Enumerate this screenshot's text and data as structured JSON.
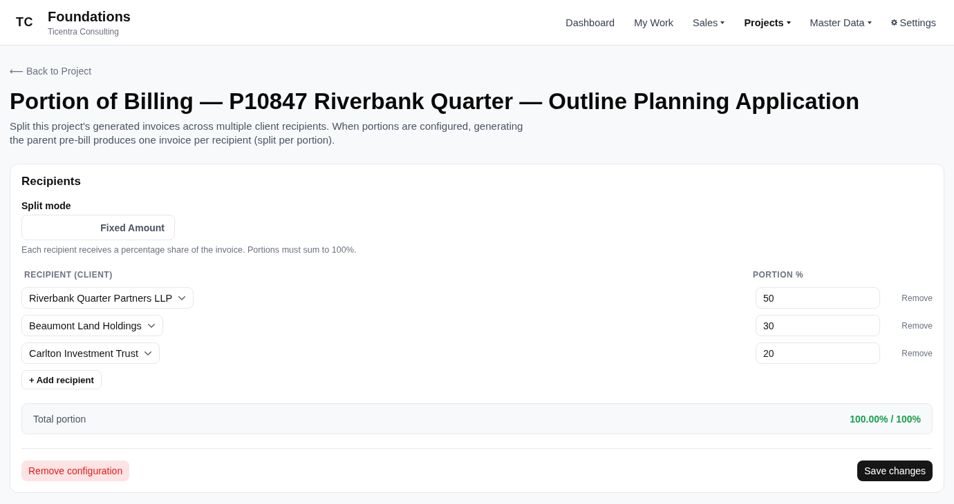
{
  "header": {
    "logo": "TC",
    "title": "Foundations",
    "subtitle": "Ticentra Consulting",
    "nav": [
      {
        "label": "Dashboard",
        "kind": "link",
        "selected": false
      },
      {
        "label": "My Work",
        "kind": "link",
        "selected": false
      },
      {
        "label": "Sales",
        "kind": "dropdown",
        "selected": false
      },
      {
        "label": "Projects",
        "kind": "dropdown",
        "selected": true
      },
      {
        "label": "Master Data",
        "kind": "dropdown",
        "selected": false
      },
      {
        "label": "Settings",
        "kind": "settings",
        "selected": false
      }
    ]
  },
  "back_link": "⟵ Back to Project",
  "title": "Portion of Billing — P10847 Riverbank Quarter — Outline Planning Application",
  "description": "Split this project's generated invoices across multiple client recipients. When portions are configured, generating the parent pre-bill produces one invoice per recipient (split per portion).",
  "recipients_card": {
    "heading": "Recipients",
    "split_mode": {
      "label": "Split mode",
      "options": [
        {
          "label": "Fixed Amount",
          "selected": false
        }
      ],
      "help": "Each recipient receives a percentage share of the invoice. Portions must sum to 100%."
    },
    "columns": [
      "RECIPIENT (CLIENT)",
      "PORTION %"
    ],
    "rows": [
      {
        "recipient": "Riverbank Quarter Partners LLP",
        "portion": "50",
        "action": "Remove"
      },
      {
        "recipient": "Beaumont Land Holdings",
        "portion": "30",
        "action": "Remove"
      },
      {
        "recipient": "Carlton Investment Trust",
        "portion": "20",
        "action": "Remove"
      }
    ],
    "add_button": "+ Add recipient",
    "total": {
      "label": "Total portion",
      "value": "100.00% / 100%",
      "valid": true
    },
    "actions": [
      {
        "label": "Remove configuration",
        "kind": "danger"
      },
      {
        "label": "Save changes",
        "kind": "primary"
      }
    ]
  }
}
